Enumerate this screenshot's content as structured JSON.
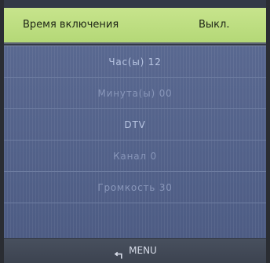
{
  "header": {
    "title": "Время включения",
    "value": "Выкл."
  },
  "menu": {
    "items": [
      {
        "label": "Час(ы) 12"
      },
      {
        "label": "Минута(ы) 00"
      },
      {
        "label": "DTV"
      },
      {
        "label": "Канал 0"
      },
      {
        "label": "Громкость 30"
      },
      {
        "label": ""
      }
    ]
  },
  "footer": {
    "label": "MENU",
    "icon": "return-arrow-icon"
  }
}
